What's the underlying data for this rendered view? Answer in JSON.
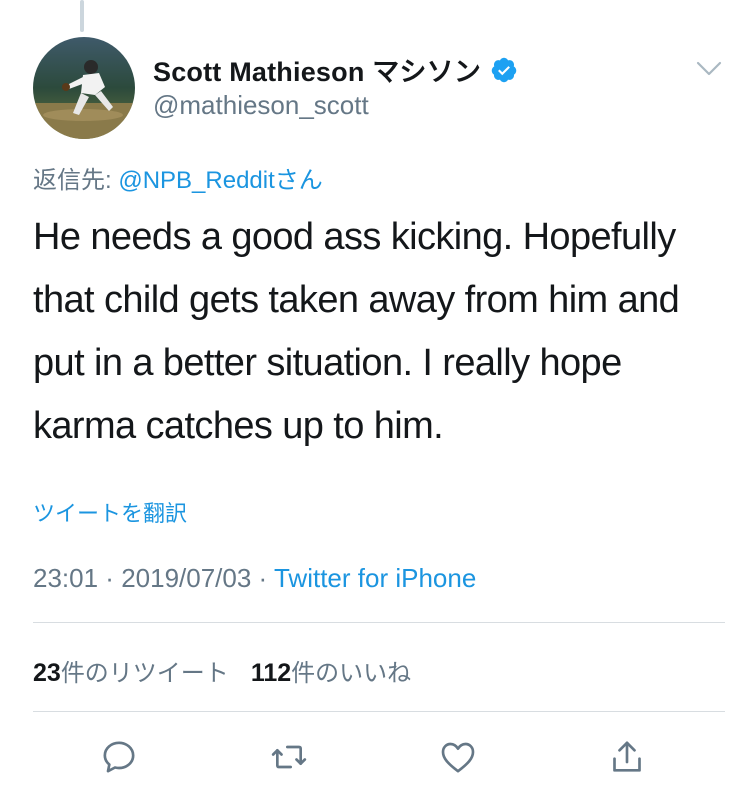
{
  "tweet": {
    "display_name": "Scott Mathieson マシソン",
    "handle": "@mathieson_scott",
    "reply_prefix": "返信先: ",
    "reply_mention": "@NPB_Reddit",
    "reply_suffix": "さん",
    "text": "He needs a good ass kicking. Hopefully that child gets taken away from him and put in a better situation. I really hope karma catches up to him.",
    "translate_label": "ツイートを翻訳",
    "time": "23:01",
    "date": "2019/07/03",
    "separator": " · ",
    "source": "Twitter for iPhone"
  },
  "stats": {
    "retweets_count": "23",
    "retweets_label": "件のリツイート",
    "likes_count": "112",
    "likes_label": "件のいいね"
  },
  "colors": {
    "link": "#1b95e0",
    "secondary_text": "#657786",
    "primary_text": "#14171a",
    "verified_badge": "#1da1f2"
  },
  "icons": [
    "verified-badge-icon",
    "chevron-down-icon",
    "reply-icon",
    "retweet-icon",
    "like-icon",
    "share-icon"
  ]
}
